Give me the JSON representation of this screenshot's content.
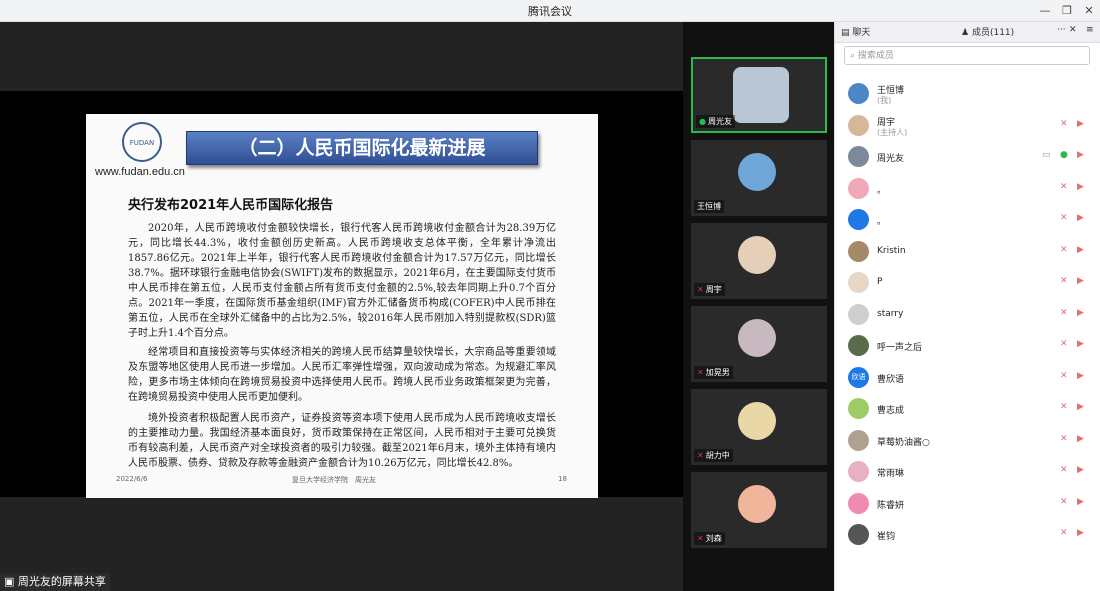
{
  "app": {
    "title": "腾讯会议"
  },
  "slide": {
    "url": "www.fudan.edu.cn",
    "banner": "（二）人民币国际化最新进展",
    "title": "央行发布2021年人民币国际化报告",
    "p1": "2020年，人民币跨境收付金额较快增长，银行代客人民币跨境收付金额合计为28.39万亿元，同比增长44.3%，收付金额创历史新高。人民币跨境收支总体平衡，全年累计净流出1857.86亿元。2021年上半年，银行代客人民币跨境收付金额合计为17.57万亿元，同比增长38.7%。据环球银行金融电信协会(SWIFT)发布的数据显示，2021年6月，在主要国际支付货币中人民币排在第五位，人民币支付金额占所有货币支付金额的2.5%,较去年同期上升0.7个百分点。2021年一季度，在国际货币基金组织(IMF)官方外汇储备货币构成(COFER)中人民币排在第五位，人民币在全球外汇储备中的占比为2.5%，较2016年人民币刚加入特别提款权(SDR)篮子时上升1.4个百分点。",
    "p2": "经常项目和直接投资等与实体经济相关的跨境人民币结算量较快增长，大宗商品等重要领域及东盟等地区使用人民币进一步增加。人民币汇率弹性增强，双向波动成为常态。为规避汇率风险，更多市场主体倾向在跨境贸易投资中选择使用人民币。跨境人民币业务政策框架更为完善，在跨境贸易投资中使用人民币更加便利。",
    "p3": "境外投资者积极配置人民币资产，证券投资等资本项下使用人民币成为人民币跨境收支增长的主要推动力量。我国经济基本面良好，货币政策保持在正常区间，人民币相对于主要可兑换货币有较高利差，人民币资产对全球投资者的吸引力较强。截至2021年6月末，境外主体持有境内人民币股票、债券、贷款及存款等金融资产金额合计为10.26万亿元，同比增长42.8%。",
    "footer_date": "2022/6/6",
    "footer_org": "复旦大学经济学院　周光友",
    "page": "18"
  },
  "videos": [
    {
      "name": "周光友",
      "color": "#b9c7d4"
    },
    {
      "name": "王恒博",
      "color": "#6fa7d8"
    },
    {
      "name": "周宇",
      "color": "#e6cfb8"
    },
    {
      "name": "加晃男",
      "color": "#c8b8c0"
    },
    {
      "name": "胡力中",
      "color": "#e9d7a8"
    },
    {
      "name": "刘森",
      "color": "#f0b59a"
    }
  ],
  "panel": {
    "tab_chat": "聊天",
    "tab_members": "成员(111)",
    "search_placeholder": "搜索成员",
    "members": [
      {
        "name": "王恒博",
        "sub": "(我)",
        "color": "#4c86c6"
      },
      {
        "name": "周宇",
        "sub": "(主持人)",
        "color": "#d7b79a"
      },
      {
        "name": "周光友",
        "sub": "",
        "color": "#7a8a9a"
      },
      {
        "name": "。",
        "sub": "",
        "color": "#f0a9b8"
      },
      {
        "name": "。",
        "sub": "",
        "color": "#1e78e6"
      },
      {
        "name": "Kristin",
        "sub": "",
        "color": "#a58a6a"
      },
      {
        "name": "P",
        "sub": "",
        "color": "#e8d6c6"
      },
      {
        "name": "starry",
        "sub": "",
        "color": "#cfcfcf"
      },
      {
        "name": "呼一声之后",
        "sub": "",
        "color": "#5a6b4a"
      },
      {
        "name": "曹欣语",
        "sub": "",
        "color": "#1e78e6",
        "initial": "欣语"
      },
      {
        "name": "曹志成",
        "sub": "",
        "color": "#9ccc65"
      },
      {
        "name": "草莓奶油酱○",
        "sub": "",
        "color": "#b0a090"
      },
      {
        "name": "常雨琳",
        "sub": "",
        "color": "#e8b0c0"
      },
      {
        "name": "陈睿妍",
        "sub": "",
        "color": "#f08ab0"
      },
      {
        "name": "崔钧",
        "sub": "",
        "color": "#555555"
      }
    ]
  },
  "statusbar": {
    "label": "周光友的屏幕共享"
  }
}
